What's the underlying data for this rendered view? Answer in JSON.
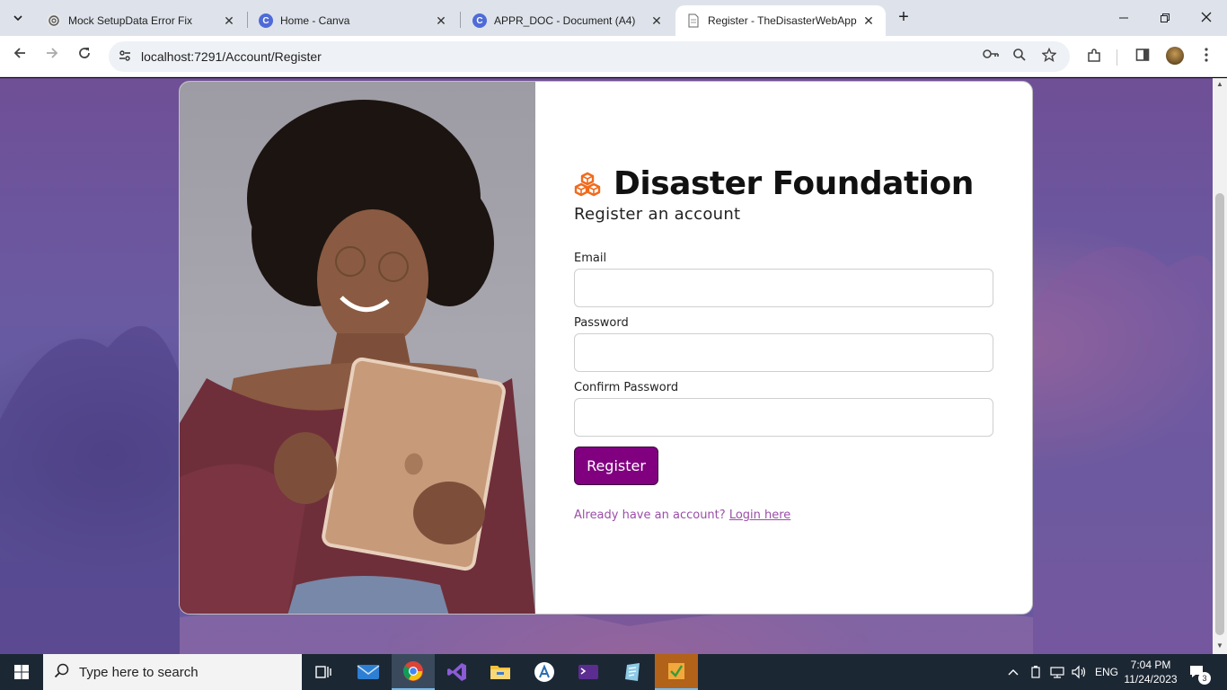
{
  "browser": {
    "tabs": [
      {
        "title": "Mock SetupData Error Fix",
        "icon": "chatgpt-icon",
        "active": false
      },
      {
        "title": "Home - Canva",
        "icon": "canva-icon",
        "active": false
      },
      {
        "title": "APPR_DOC - Document (A4)",
        "icon": "canva-icon",
        "active": false
      },
      {
        "title": "Register - TheDisasterWebApp",
        "icon": "page-icon",
        "active": true
      }
    ],
    "url": "localhost:7291/Account/Register"
  },
  "page": {
    "brand_title": "Disaster Foundation",
    "subtitle": "Register an account",
    "email_label": "Email",
    "email_value": "",
    "password_label": "Password",
    "password_value": "",
    "confirm_label": "Confirm Password",
    "confirm_value": "",
    "register_button": "Register",
    "login_prompt": "Already have an account?",
    "login_link": "Login here",
    "accent_color": "#800080",
    "brand_icon_color": "#f26a1b"
  },
  "taskbar": {
    "search_placeholder": "Type here to search",
    "language": "ENG",
    "time": "7:04 PM",
    "date": "11/24/2023",
    "notification_count": "3"
  }
}
